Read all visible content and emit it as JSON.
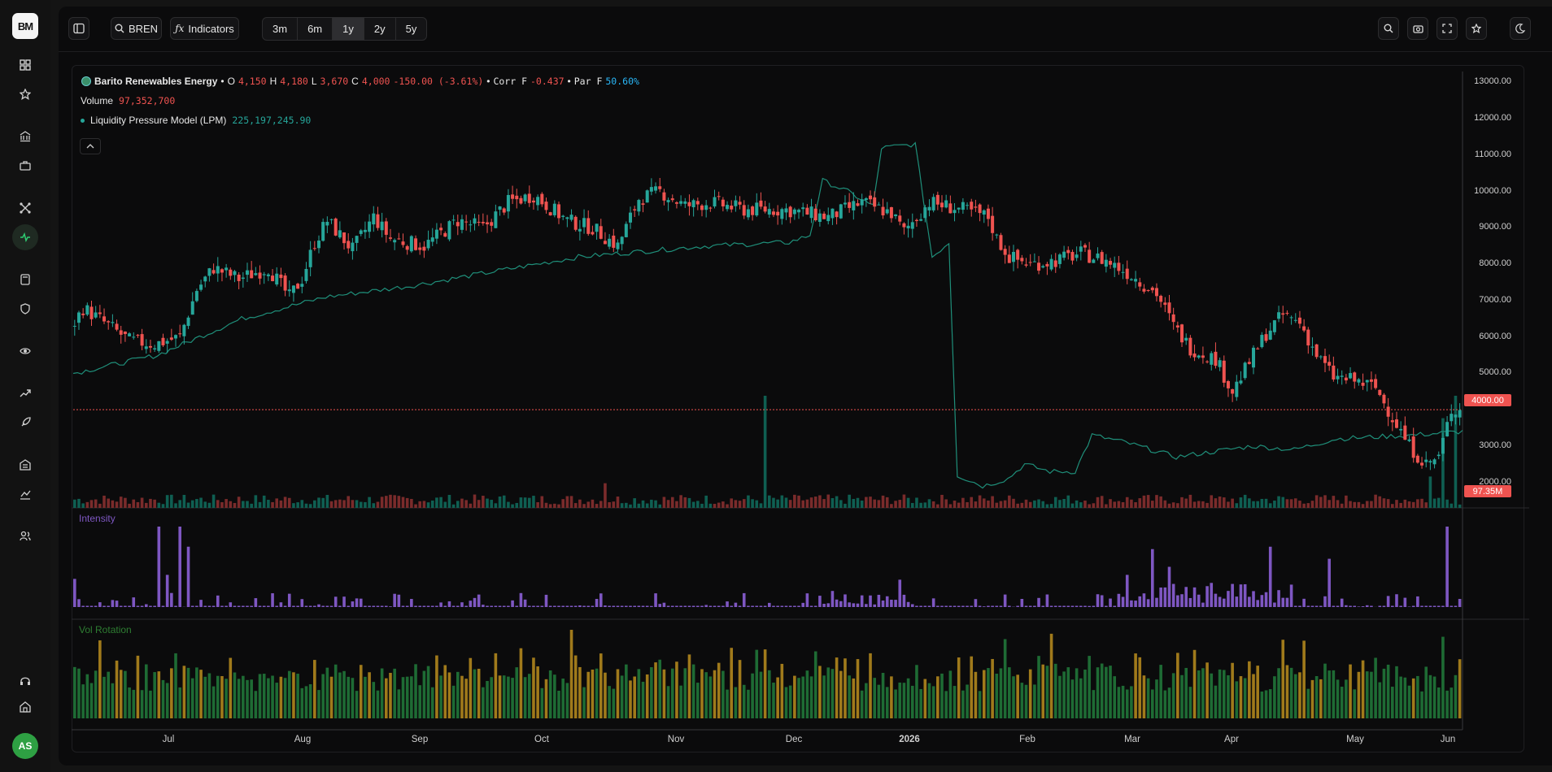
{
  "sidebar": {
    "logo": "BM",
    "items": [
      {
        "name": "dashboard-icon"
      },
      {
        "name": "star-icon"
      },
      {
        "name": "bank-icon"
      },
      {
        "name": "briefcase-icon"
      },
      {
        "name": "network-icon"
      },
      {
        "name": "activity-icon"
      },
      {
        "name": "calculator-icon"
      },
      {
        "name": "shield-icon"
      },
      {
        "name": "eye-icon"
      },
      {
        "name": "trending-up-icon"
      },
      {
        "name": "rocket-icon"
      },
      {
        "name": "building-icon"
      },
      {
        "name": "line-chart-icon"
      },
      {
        "name": "users-icon"
      },
      {
        "name": "headset-icon"
      },
      {
        "name": "home-icon"
      }
    ],
    "avatar": "AS"
  },
  "toolbar": {
    "symbol": "BREN",
    "indicators_label": "Indicators",
    "ranges": [
      "3m",
      "6m",
      "1y",
      "2y",
      "5y"
    ],
    "active_range": "1y",
    "right_icons": [
      "search-icon",
      "camera-icon",
      "fullscreen-icon",
      "star-icon",
      "theme-icon"
    ]
  },
  "legend": {
    "name": "Barito Renewables Energy",
    "o_label": "O",
    "o": "4,150",
    "h_label": "H",
    "h": "4,180",
    "l_label": "L",
    "l": "3,670",
    "c_label": "C",
    "c": "4,000",
    "change": "-150.00 (-3.61%)",
    "corr_label": "Corr F",
    "corr": "-0.437",
    "par_label": "Par F",
    "par": "50.60%",
    "volume_label": "Volume",
    "volume": "97,352,700",
    "lpm_label": "Liquidity Pressure Model (LPM)",
    "lpm": "225,197,245.90"
  },
  "panes": {
    "intensity_label": "Intensity",
    "vol_rotation_label": "Vol Rotation"
  },
  "colors": {
    "up": "#26a69a",
    "down": "#ef5350",
    "lpm": "#1f8f7a",
    "intensity": "#7e57c2",
    "rot_green": "#1e6b34",
    "rot_gold": "#a07a1b",
    "par": "#29b6f6"
  },
  "axis": {
    "y_labels": [
      "13000.00",
      "12000.00",
      "11000.00",
      "10000.00",
      "9000.00",
      "8000.00",
      "7000.00",
      "6000.00",
      "5000.00",
      "3000.00",
      "2000.00"
    ],
    "last_price_tag": "4000.00",
    "volume_tag": "97.35M",
    "x_labels": [
      "Jul",
      "Aug",
      "Sep",
      "Oct",
      "Nov",
      "Dec",
      "2026",
      "Feb",
      "Mar",
      "Apr",
      "May",
      "Jun"
    ]
  },
  "chart_data": {
    "type": "candlestick",
    "ylim": [
      1300,
      13300
    ],
    "price_path": [
      {
        "x": 0,
        "y": 6200
      },
      {
        "x": 3,
        "y": 6800
      },
      {
        "x": 8,
        "y": 6400
      },
      {
        "x": 14,
        "y": 5900
      },
      {
        "x": 20,
        "y": 5800
      },
      {
        "x": 26,
        "y": 6000
      },
      {
        "x": 30,
        "y": 7300
      },
      {
        "x": 34,
        "y": 7900
      },
      {
        "x": 40,
        "y": 7600
      },
      {
        "x": 47,
        "y": 7900
      },
      {
        "x": 52,
        "y": 7100
      },
      {
        "x": 55,
        "y": 7600
      },
      {
        "x": 58,
        "y": 8600
      },
      {
        "x": 61,
        "y": 9200
      },
      {
        "x": 67,
        "y": 8400
      },
      {
        "x": 72,
        "y": 9300
      },
      {
        "x": 76,
        "y": 8700
      },
      {
        "x": 84,
        "y": 8500
      },
      {
        "x": 92,
        "y": 9200
      },
      {
        "x": 98,
        "y": 9000
      },
      {
        "x": 104,
        "y": 9700
      },
      {
        "x": 110,
        "y": 9900
      },
      {
        "x": 118,
        "y": 9200
      },
      {
        "x": 124,
        "y": 9000
      },
      {
        "x": 130,
        "y": 8500
      },
      {
        "x": 135,
        "y": 9800
      },
      {
        "x": 140,
        "y": 10000
      },
      {
        "x": 146,
        "y": 9600
      },
      {
        "x": 152,
        "y": 9700
      },
      {
        "x": 160,
        "y": 9500
      },
      {
        "x": 170,
        "y": 9500
      },
      {
        "x": 180,
        "y": 9300
      },
      {
        "x": 188,
        "y": 9700
      },
      {
        "x": 195,
        "y": 9400
      },
      {
        "x": 198,
        "y": 8900
      },
      {
        "x": 204,
        "y": 9700
      },
      {
        "x": 212,
        "y": 9500
      },
      {
        "x": 218,
        "y": 9300
      },
      {
        "x": 220,
        "y": 8700
      },
      {
        "x": 223,
        "y": 8200
      },
      {
        "x": 228,
        "y": 8000
      },
      {
        "x": 234,
        "y": 8100
      },
      {
        "x": 240,
        "y": 8300
      },
      {
        "x": 246,
        "y": 8100
      },
      {
        "x": 252,
        "y": 7700
      },
      {
        "x": 258,
        "y": 7200
      },
      {
        "x": 262,
        "y": 6300
      },
      {
        "x": 266,
        "y": 5700
      },
      {
        "x": 272,
        "y": 5400
      },
      {
        "x": 276,
        "y": 4500
      },
      {
        "x": 280,
        "y": 5300
      },
      {
        "x": 284,
        "y": 6100
      },
      {
        "x": 288,
        "y": 6600
      },
      {
        "x": 292,
        "y": 6400
      },
      {
        "x": 296,
        "y": 5500
      },
      {
        "x": 300,
        "y": 4900
      },
      {
        "x": 305,
        "y": 4800
      },
      {
        "x": 310,
        "y": 4600
      },
      {
        "x": 314,
        "y": 3800
      },
      {
        "x": 318,
        "y": 3000
      },
      {
        "x": 322,
        "y": 2500
      },
      {
        "x": 325,
        "y": 2700
      },
      {
        "x": 328,
        "y": 4000
      },
      {
        "x": 330,
        "y": 4000
      }
    ],
    "lpm_path": [
      {
        "x": 0,
        "y": 5000
      },
      {
        "x": 20,
        "y": 5500
      },
      {
        "x": 40,
        "y": 6500
      },
      {
        "x": 60,
        "y": 7100
      },
      {
        "x": 80,
        "y": 7400
      },
      {
        "x": 100,
        "y": 7800
      },
      {
        "x": 120,
        "y": 8200
      },
      {
        "x": 150,
        "y": 8500
      },
      {
        "x": 170,
        "y": 8600
      },
      {
        "x": 175,
        "y": 8800
      },
      {
        "x": 178,
        "y": 10300
      },
      {
        "x": 184,
        "y": 10000
      },
      {
        "x": 190,
        "y": 9600
      },
      {
        "x": 192,
        "y": 11200
      },
      {
        "x": 200,
        "y": 11300
      },
      {
        "x": 204,
        "y": 8200
      },
      {
        "x": 208,
        "y": 8600
      },
      {
        "x": 210,
        "y": 2200
      },
      {
        "x": 216,
        "y": 1900
      },
      {
        "x": 222,
        "y": 2100
      },
      {
        "x": 226,
        "y": 2500
      },
      {
        "x": 232,
        "y": 2300
      },
      {
        "x": 238,
        "y": 2300
      },
      {
        "x": 242,
        "y": 3300
      },
      {
        "x": 250,
        "y": 3100
      },
      {
        "x": 262,
        "y": 2700
      },
      {
        "x": 280,
        "y": 3000
      },
      {
        "x": 290,
        "y": 2900
      },
      {
        "x": 300,
        "y": 3200
      },
      {
        "x": 318,
        "y": 3300
      },
      {
        "x": 330,
        "y": 3400
      }
    ],
    "volume_spikes": [
      {
        "x": 164,
        "v": 100
      },
      {
        "x": 126,
        "v": 22
      },
      {
        "x": 328,
        "v": 100
      },
      {
        "x": 325,
        "v": 80
      },
      {
        "x": 322,
        "v": 28
      }
    ],
    "intensity_spikes": [
      {
        "x": 0,
        "v": 35
      },
      {
        "x": 14,
        "v": 12
      },
      {
        "x": 20,
        "v": 100
      },
      {
        "x": 22,
        "v": 40
      },
      {
        "x": 25,
        "v": 100
      },
      {
        "x": 27,
        "v": 75
      },
      {
        "x": 180,
        "v": 20
      },
      {
        "x": 196,
        "v": 34
      },
      {
        "x": 250,
        "v": 40
      },
      {
        "x": 256,
        "v": 72
      },
      {
        "x": 260,
        "v": 50
      },
      {
        "x": 270,
        "v": 30
      },
      {
        "x": 284,
        "v": 75
      },
      {
        "x": 298,
        "v": 60
      },
      {
        "x": 326,
        "v": 100
      }
    ]
  }
}
